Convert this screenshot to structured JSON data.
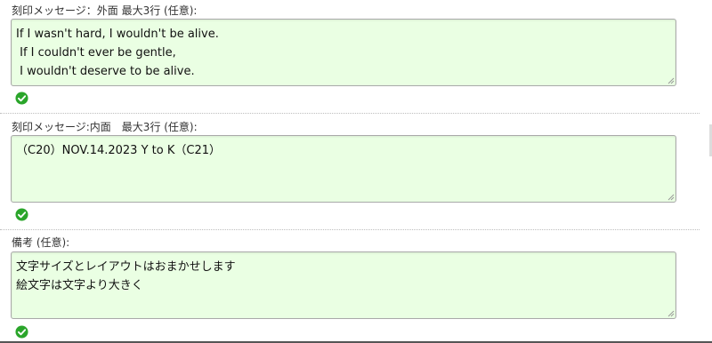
{
  "outer_message": {
    "label": "刻印メッセージ：外面 最大3行 (任意):",
    "lines": [
      "If I wasn't hard, I wouldn't be alive.",
      " If I couldn't ever be gentle,",
      " I wouldn't deserve to be alive."
    ],
    "status_icon": "check-circle-icon"
  },
  "inner_message": {
    "label": "刻印メッセージ:内面　最大3行 (任意):",
    "lines": [
      "（C20）NOV.14.2023 Y to K（C21）"
    ],
    "status_icon": "check-circle-icon"
  },
  "remarks": {
    "label": "備考 (任意):",
    "lines": [
      "文字サイズとレイアウトはおまかせします",
      "絵文字は文字より大きく"
    ],
    "status_icon": "check-circle-icon"
  },
  "colors": {
    "field_bg": "#eaffe3",
    "valid_green": "#2aa52a"
  }
}
